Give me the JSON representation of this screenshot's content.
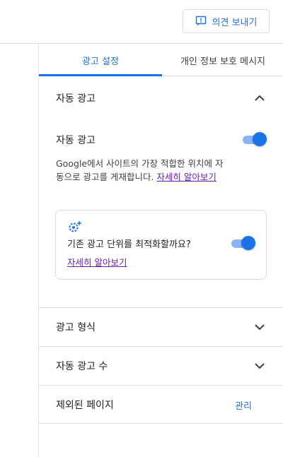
{
  "topbar": {
    "feedback_label": "의견 보내기"
  },
  "tabs": [
    {
      "label": "광고 설정",
      "active": true
    },
    {
      "label": "개인 정보 보호 메시지",
      "active": false
    }
  ],
  "auto_ads": {
    "section_title": "자동 광고",
    "expanded": true,
    "toggle_label": "자동 광고",
    "toggle_on": true,
    "description": "Google에서 사이트의 가장 적합한 위치에 자동으로 광고를 게재합니다.",
    "learn_more": "자세히 알아보기",
    "card": {
      "question": "기존 광고 단위를 최적화할까요?",
      "toggle_on": true,
      "learn_more": "자세히 알아보기"
    }
  },
  "sections": [
    {
      "title": "광고 형식",
      "expanded": false
    },
    {
      "title": "자동 광고 수",
      "expanded": false
    }
  ],
  "excluded_pages": {
    "title": "제외된 페이지",
    "action": "관리"
  },
  "colors": {
    "accent": "#1a73e8",
    "link_visited": "#681da8",
    "toggle_track": "#8ab4f8"
  }
}
